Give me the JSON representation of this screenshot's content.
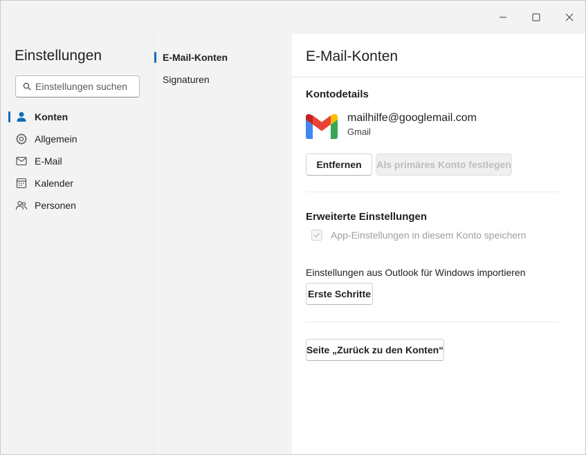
{
  "window": {
    "controls": [
      "minimize-icon",
      "maximize-icon",
      "close-icon"
    ]
  },
  "sidebar": {
    "title": "Einstellungen",
    "search_placeholder": "Einstellungen suchen",
    "items": [
      {
        "label": "Konten",
        "icon": "person-icon",
        "active": true
      },
      {
        "label": "Allgemein",
        "icon": "gear-icon",
        "active": false
      },
      {
        "label": "E-Mail",
        "icon": "mail-icon",
        "active": false
      },
      {
        "label": "Kalender",
        "icon": "calendar-icon",
        "active": false
      },
      {
        "label": "Personen",
        "icon": "people-icon",
        "active": false
      }
    ]
  },
  "subnav": {
    "items": [
      {
        "label": "E-Mail-Konten",
        "active": true
      },
      {
        "label": "Signaturen",
        "active": false
      }
    ]
  },
  "content": {
    "title": "E-Mail-Konten",
    "account_section_title": "Kontodetails",
    "account": {
      "email": "mailhilfe@googlemail.com",
      "type": "Gmail",
      "logo": "gmail-logo-icon"
    },
    "remove_button": "Entfernen",
    "primary_button": "Als primäres Konto festlegen",
    "advanced_title": "Erweiterte Einstellungen",
    "save_app_settings_label": "App-Einstellungen in diesem Konto speichern",
    "save_app_settings_checked": true,
    "import_label": "Einstellungen aus Outlook für Windows importieren",
    "get_started_button": "Erste Schritte",
    "back_button": "Seite „Zurück zu den Konten“"
  },
  "colors": {
    "accent": "#0f6cbd",
    "sidebar_bg": "#f3f3f3",
    "content_bg": "#ffffff",
    "disabled_text": "#bdbdbd"
  }
}
